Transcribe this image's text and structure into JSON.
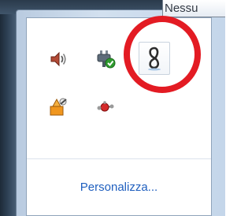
{
  "tooltip": {
    "text": "Nessu"
  },
  "flyout": {
    "icons": [
      {
        "name": "volume-icon",
        "row": 1
      },
      {
        "name": "network-icon",
        "row": 1
      },
      {
        "name": "sync-app-icon",
        "row": 1,
        "selected": true
      },
      {
        "name": "user-update-icon",
        "row": 2
      },
      {
        "name": "bluetooth-device-icon",
        "row": 2
      }
    ],
    "customize_label": "Personalizza..."
  },
  "colors": {
    "link": "#1f5fbf",
    "highlight_circle": "#e31b23"
  }
}
